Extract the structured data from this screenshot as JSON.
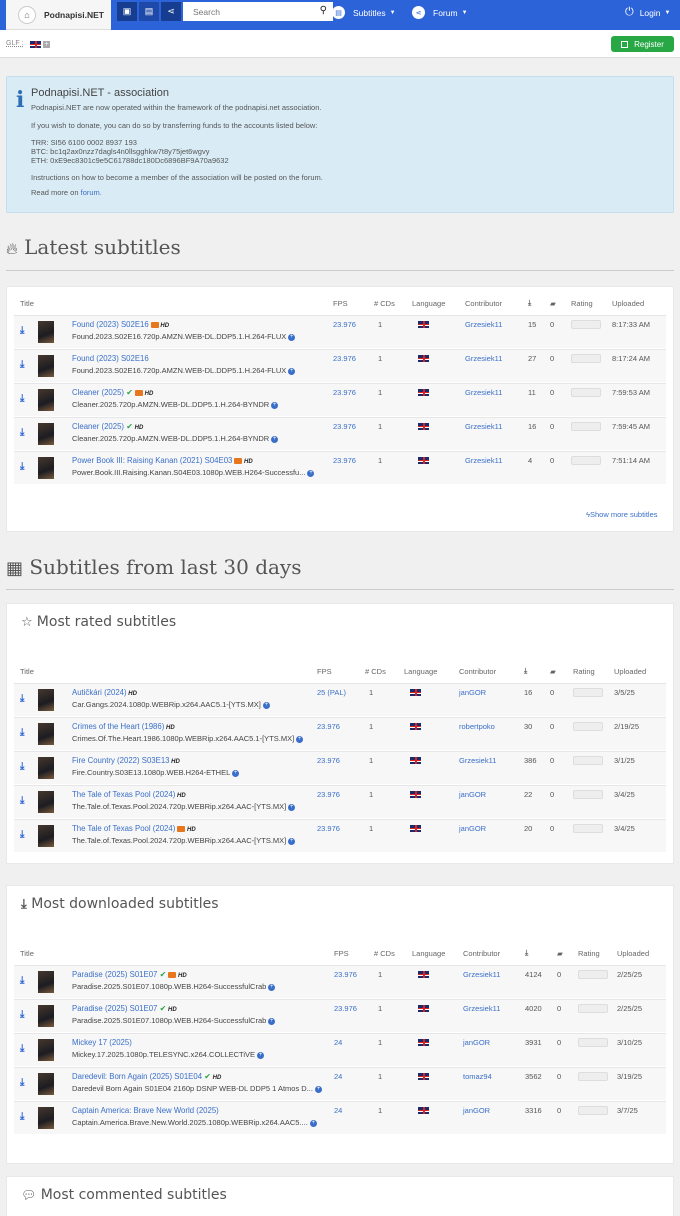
{
  "nav": {
    "brand": "Podnapisi.NET",
    "search_placeholder": "Search",
    "subtitles": "Subtitles",
    "forum": "Forum",
    "login": "Login"
  },
  "topbar": {
    "glf": "GLF :",
    "register": "Register"
  },
  "info": {
    "title": "Podnapisi.NET - association",
    "line1": "Podnapisi.NET are now operated within the framework of the podnapisi.net association.",
    "line2": "If you wish to donate, you can do so by transferring funds to the accounts listed below:",
    "trr": "TRR: SI56 6100 0002 8937 193",
    "btc": "BTC: bc1q2ax0nzz7dagls4n0llsgghkw7t8y75jet6wgvy",
    "eth": "ETH: 0xE9ec8301c9e5C61788dc180Dc6896BF9A70a9632",
    "line3": "Instructions on how to become a member of the association will be posted on the forum.",
    "readmore": "Read more on",
    "forum_link": "forum."
  },
  "sections": {
    "latest": "Latest subtitles",
    "last30": "Subtitles from last 30 days",
    "most_rated": "Most rated subtitles",
    "most_downloaded": "Most downloaded subtitles",
    "most_commented": "Most commented subtitles",
    "show_more": "Show more subtitles"
  },
  "columns": {
    "title": "Title",
    "fps": "FPS",
    "cds": "# CDs",
    "language": "Language",
    "contributor": "Contributor",
    "rating": "Rating",
    "uploaded": "Uploaded"
  },
  "latest_rows": [
    {
      "title": "Found (2023) S02E16",
      "release": "Found.2023.S02E16.720p.AMZN.WEB-DL.DDP5.1.H.264-FLUX",
      "fps": "23.976",
      "cds": "1",
      "contributor": "Grzesiek11",
      "downloads": "15",
      "comments": "0",
      "uploaded": "8:17:33 AM",
      "hi": true,
      "hd": true,
      "check": false
    },
    {
      "title": "Found (2023) S02E16",
      "release": "Found.2023.S02E16.720p.AMZN.WEB-DL.DDP5.1.H.264-FLUX",
      "fps": "23.976",
      "cds": "1",
      "contributor": "Grzesiek11",
      "downloads": "27",
      "comments": "0",
      "uploaded": "8:17:24 AM",
      "hi": false,
      "hd": false,
      "check": false
    },
    {
      "title": "Cleaner (2025)",
      "release": "Cleaner.2025.720p.AMZN.WEB-DL.DDP5.1.H.264-BYNDR",
      "fps": "23.976",
      "cds": "1",
      "contributor": "Grzesiek11",
      "downloads": "11",
      "comments": "0",
      "uploaded": "7:59:53 AM",
      "hi": true,
      "hd": true,
      "check": true
    },
    {
      "title": "Cleaner (2025)",
      "release": "Cleaner.2025.720p.AMZN.WEB-DL.DDP5.1.H.264-BYNDR",
      "fps": "23.976",
      "cds": "1",
      "contributor": "Grzesiek11",
      "downloads": "16",
      "comments": "0",
      "uploaded": "7:59:45 AM",
      "hi": false,
      "hd": true,
      "check": true
    },
    {
      "title": "Power Book III: Raising Kanan (2021) S04E03",
      "release": "Power.Book.III.Raising.Kanan.S04E03.1080p.WEB.H264-Successfu...",
      "fps": "23.976",
      "cds": "1",
      "contributor": "Grzesiek11",
      "downloads": "4",
      "comments": "0",
      "uploaded": "7:51:14 AM",
      "hi": true,
      "hd": true,
      "check": false
    }
  ],
  "rated_rows": [
    {
      "title": "Autičkári (2024)",
      "release": "Car.Gangs.2024.1080p.WEBRip.x264.AAC5.1-[YTS.MX]",
      "fps": "25 (PAL)",
      "cds": "1",
      "contributor": "janGOR",
      "downloads": "16",
      "comments": "0",
      "uploaded": "3/5/25",
      "hi": false,
      "hd": true,
      "check": false
    },
    {
      "title": "Crimes of the Heart (1986)",
      "release": "Crimes.Of.The.Heart.1986.1080p.WEBRip.x264.AAC5.1-[YTS.MX]",
      "fps": "23.976",
      "cds": "1",
      "contributor": "robertpoko",
      "downloads": "30",
      "comments": "0",
      "uploaded": "2/19/25",
      "hi": false,
      "hd": true,
      "check": false
    },
    {
      "title": "Fire Country (2022) S03E13",
      "release": "Fire.Country.S03E13.1080p.WEB.H264-ETHEL",
      "fps": "23.976",
      "cds": "1",
      "contributor": "Grzesiek11",
      "downloads": "386",
      "comments": "0",
      "uploaded": "3/1/25",
      "hi": false,
      "hd": true,
      "check": false
    },
    {
      "title": "The Tale of Texas Pool (2024)",
      "release": "The.Tale.of.Texas.Pool.2024.720p.WEBRip.x264.AAC-[YTS.MX]",
      "fps": "23.976",
      "cds": "1",
      "contributor": "janGOR",
      "downloads": "22",
      "comments": "0",
      "uploaded": "3/4/25",
      "hi": false,
      "hd": true,
      "check": false
    },
    {
      "title": "The Tale of Texas Pool (2024)",
      "release": "The.Tale.of.Texas.Pool.2024.720p.WEBRip.x264.AAC-[YTS.MX]",
      "fps": "23.976",
      "cds": "1",
      "contributor": "janGOR",
      "downloads": "20",
      "comments": "0",
      "uploaded": "3/4/25",
      "hi": true,
      "hd": true,
      "check": false
    }
  ],
  "downloaded_rows": [
    {
      "title": "Paradise (2025) S01E07",
      "release": "Paradise.2025.S01E07.1080p.WEB.H264-SuccessfulCrab",
      "fps": "23.976",
      "cds": "1",
      "contributor": "Grzesiek11",
      "downloads": "4124",
      "comments": "0",
      "uploaded": "2/25/25",
      "hi": true,
      "hd": true,
      "check": true
    },
    {
      "title": "Paradise (2025) S01E07",
      "release": "Paradise.2025.S01E07.1080p.WEB.H264-SuccessfulCrab",
      "fps": "23.976",
      "cds": "1",
      "contributor": "Grzesiek11",
      "downloads": "4020",
      "comments": "0",
      "uploaded": "2/25/25",
      "hi": false,
      "hd": true,
      "check": true
    },
    {
      "title": "Mickey 17 (2025)",
      "release": "Mickey.17.2025.1080p.TELESYNC.x264.COLLECTiVE",
      "fps": "24",
      "cds": "1",
      "contributor": "janGOR",
      "downloads": "3931",
      "comments": "0",
      "uploaded": "3/10/25",
      "hi": false,
      "hd": false,
      "check": false
    },
    {
      "title": "Daredevil: Born Again (2025) S01E04",
      "release": "Daredevil Born Again S01E04 2160p DSNP WEB-DL DDP5 1 Atmos D...",
      "fps": "24",
      "cds": "1",
      "contributor": "tomaz94",
      "downloads": "3562",
      "comments": "0",
      "uploaded": "3/19/25",
      "hi": false,
      "hd": true,
      "check": true
    },
    {
      "title": "Captain America: Brave New World (2025)",
      "release": "Captain.America.Brave.New.World.2025.1080p.WEBRip.x264.AAC5....",
      "fps": "24",
      "cds": "1",
      "contributor": "janGOR",
      "downloads": "3316",
      "comments": "0",
      "uploaded": "3/7/25",
      "hi": false,
      "hd": false,
      "check": false
    }
  ]
}
